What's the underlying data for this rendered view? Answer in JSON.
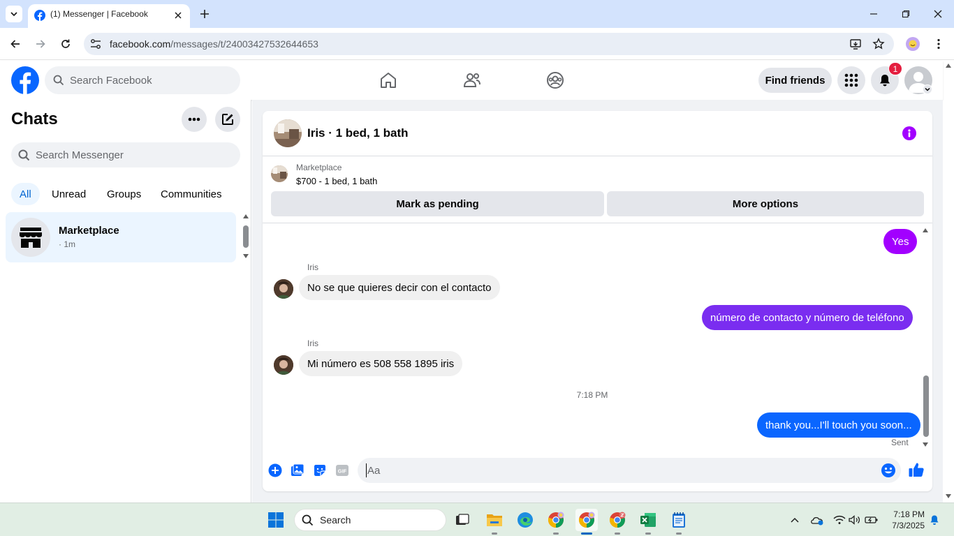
{
  "browser": {
    "tab_title": "(1) Messenger | Facebook",
    "url_host": "facebook.com",
    "url_path": "/messages/t/24003427532644653"
  },
  "fb_nav": {
    "search_placeholder": "Search Facebook",
    "find_friends_label": "Find friends",
    "notification_count": "1"
  },
  "sidebar": {
    "title": "Chats",
    "search_placeholder": "Search Messenger",
    "filters": [
      "All",
      "Unread",
      "Groups",
      "Communities"
    ],
    "active_filter": "All",
    "chats": [
      {
        "name": "Marketplace",
        "time": "· 1m"
      }
    ]
  },
  "conversation": {
    "title": "Iris · 1 bed, 1 bath",
    "listing": {
      "label": "Marketplace",
      "price_title": "$700 - 1 bed, 1 bath",
      "mark_pending_label": "Mark as pending",
      "more_options_label": "More options"
    },
    "messages": [
      {
        "direction": "out",
        "text": "Yes"
      },
      {
        "direction": "in",
        "sender": "Iris",
        "text": "No se que quieres  decir  con el contacto"
      },
      {
        "direction": "out",
        "text": "número de contacto y número de teléfono"
      },
      {
        "direction": "in",
        "sender": "Iris",
        "text": "Mi número  es 508 558 1895  iris"
      },
      {
        "direction": "time",
        "text": "7:18 PM"
      },
      {
        "direction": "out",
        "text": "thank you...I'll touch you soon...",
        "status": "Sent"
      }
    ],
    "composer_placeholder": "Aa"
  },
  "colors": {
    "fb_blue": "#0866ff",
    "bubble_purple": "#a200ff",
    "bubble_violet": "#7a2df0",
    "bubble_blue": "#0a66ff",
    "incoming_bubble": "#f0f0f0"
  },
  "taskbar": {
    "search_label": "Search",
    "time": "7:18 PM",
    "date": "7/3/2025"
  }
}
